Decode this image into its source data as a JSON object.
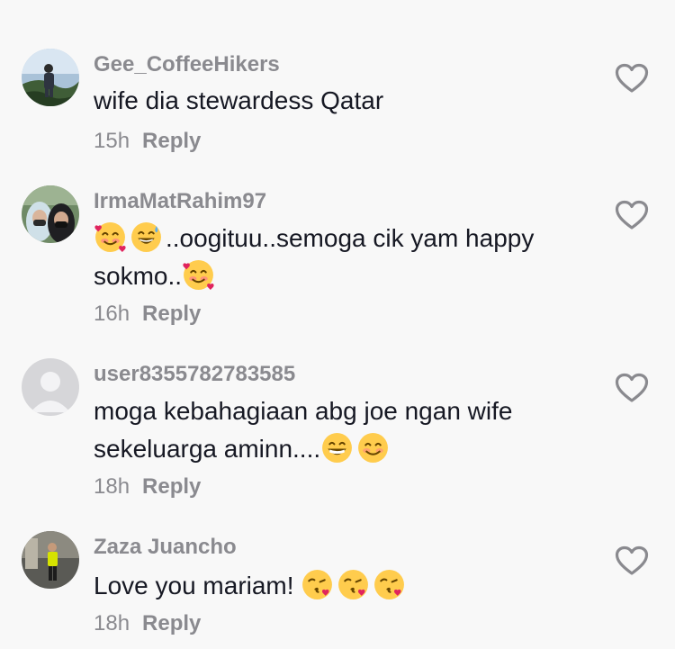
{
  "comments": [
    {
      "username": "Gee_CoffeeHikers",
      "text_lines": [
        "wife dia stewardess Qatar"
      ],
      "time": "15h",
      "reply_label": "Reply",
      "avatar_icon": "hiker-photo-avatar",
      "like_icon": "heart-outline-icon"
    },
    {
      "username": "IrmaMatRahim97",
      "text_line1": "..oogituu..semoga cik yam happy",
      "text_line2": "sokmo..",
      "emojis_line1": [
        "smiling-face-with-hearts",
        "grinning-sweat-face"
      ],
      "emojis_line2": [
        "smiling-face-with-hearts"
      ],
      "time": "16h",
      "reply_label": "Reply",
      "avatar_icon": "two-women-photo-avatar",
      "like_icon": "heart-outline-icon"
    },
    {
      "username": "user8355782783585",
      "text_line1": "moga kebahagiaan abg joe ngan wife",
      "text_line2": "sekeluarga aminn....",
      "emojis_line2": [
        "grinning-face",
        "smiling-face"
      ],
      "time": "18h",
      "reply_label": "Reply",
      "avatar_icon": "default-user-avatar",
      "like_icon": "heart-outline-icon"
    },
    {
      "username": "Zaza Juancho",
      "text_line1": "Love you mariam!",
      "emojis_line1": [
        "face-blowing-kiss",
        "face-blowing-kiss",
        "face-blowing-kiss"
      ],
      "time": "18h",
      "reply_label": "Reply",
      "avatar_icon": "person-photo-avatar",
      "like_icon": "heart-outline-icon"
    }
  ],
  "colors": {
    "background": "#f8f8f8",
    "text_primary": "#161823",
    "text_secondary": "#8a8a8f",
    "icon": "#8a8a8f"
  }
}
